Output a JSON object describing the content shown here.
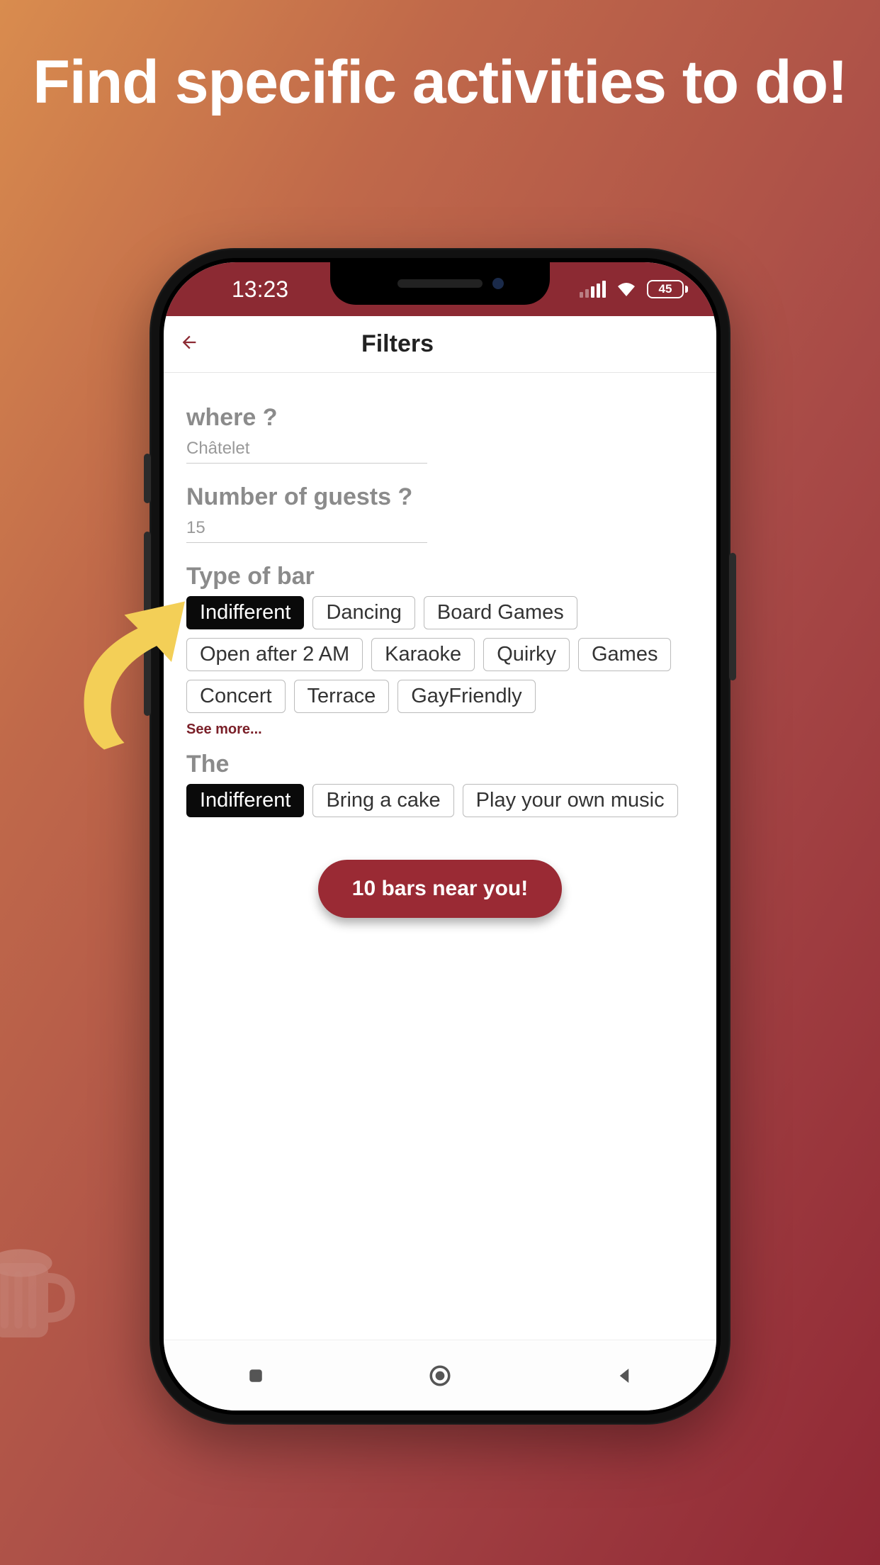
{
  "marketing": {
    "headline": "Find specific activities to do!"
  },
  "statusbar": {
    "time": "13:23",
    "battery": "45"
  },
  "header": {
    "title": "Filters"
  },
  "filters": {
    "where_label": "where ?",
    "where_value": "Châtelet",
    "guests_label": "Number of guests ?",
    "guests_value": "15",
    "type_label": "Type of bar",
    "see_more": "See more...",
    "the_label": "The"
  },
  "type_chips": [
    {
      "label": "Indifferent",
      "selected": true
    },
    {
      "label": "Dancing",
      "selected": false
    },
    {
      "label": "Board Games",
      "selected": false
    },
    {
      "label": "Open after 2 AM",
      "selected": false
    },
    {
      "label": "Karaoke",
      "selected": false
    },
    {
      "label": "Quirky",
      "selected": false
    },
    {
      "label": "Games",
      "selected": false
    },
    {
      "label": "Concert",
      "selected": false
    },
    {
      "label": "Terrace",
      "selected": false
    },
    {
      "label": "GayFriendly",
      "selected": false
    }
  ],
  "the_chips": [
    {
      "label": "Indifferent",
      "selected": true
    },
    {
      "label": "Bring a cake",
      "selected": false
    },
    {
      "label": "Play your own music",
      "selected": false
    }
  ],
  "cta": {
    "label": "10 bars near you!"
  },
  "colors": {
    "accent": "#9a2a34"
  }
}
